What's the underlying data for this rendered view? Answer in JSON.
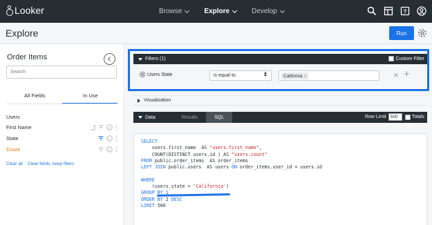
{
  "app": {
    "name": "Looker"
  },
  "nav": {
    "items": [
      {
        "label": "Browse",
        "active": false
      },
      {
        "label": "Explore",
        "active": true
      },
      {
        "label": "Develop",
        "active": false
      }
    ],
    "icons": [
      "search-icon",
      "marketplace-icon",
      "help-icon",
      "user-icon"
    ]
  },
  "header": {
    "title": "Explore",
    "run_label": "Run"
  },
  "sidebar": {
    "title": "Order Items",
    "search_placeholder": "Search",
    "tabs": [
      {
        "label": "All Fields",
        "active": false
      },
      {
        "label": "In Use",
        "active": true
      }
    ],
    "group_label": "Users",
    "fields": [
      {
        "label": "First Name",
        "color": "#262d33",
        "filter_active": false
      },
      {
        "label": "State",
        "color": "#262d33",
        "filter_active": true
      },
      {
        "label": "Count",
        "color": "#e8710a",
        "filter_active": false
      }
    ],
    "links": {
      "clear_all": "Clear all",
      "clear_keep": "Clear fields, keep filters"
    }
  },
  "filters": {
    "header": "Filters (1)",
    "custom_filter_label": "Custom Filter",
    "rows": [
      {
        "field": "Users State",
        "operator": "is equal to",
        "value": "California"
      }
    ]
  },
  "visualization": {
    "label": "Visualization"
  },
  "data_panel": {
    "label": "Data",
    "tabs": [
      {
        "label": "Results",
        "active": false
      },
      {
        "label": "SQL",
        "active": true
      }
    ],
    "row_limit_label": "Row Limit",
    "row_limit_value": "500",
    "totals_label": "Totals"
  },
  "sql": {
    "lines": [
      [
        {
          "t": "SELECT",
          "c": "kw"
        }
      ],
      [
        {
          "t": "    users.first_name  AS ",
          "c": ""
        },
        {
          "t": "\"users.first_name\"",
          "c": "str"
        },
        {
          "t": ",",
          "c": ""
        }
      ],
      [
        {
          "t": "    COUNT(DISTINCT users.id ) AS ",
          "c": ""
        },
        {
          "t": "\"users.count\"",
          "c": "str"
        }
      ],
      [
        {
          "t": "FROM",
          "c": "kw"
        },
        {
          "t": " public.order_items  AS order_items",
          "c": ""
        }
      ],
      [
        {
          "t": "LEFT JOIN",
          "c": "kw"
        },
        {
          "t": " public.users  AS users ",
          "c": ""
        },
        {
          "t": "ON",
          "c": "kw"
        },
        {
          "t": " order_items.user_id = users.id",
          "c": ""
        }
      ],
      [
        {
          "t": "",
          "c": ""
        }
      ],
      [
        {
          "t": "WHERE",
          "c": "kw"
        }
      ],
      [
        {
          "t": "    (users.state = ",
          "c": ""
        },
        {
          "t": "'California'",
          "c": "str"
        },
        {
          "t": ")",
          "c": ""
        }
      ],
      [
        {
          "t": "GROUP BY 1",
          "c": "kw"
        }
      ],
      [
        {
          "t": "ORDER BY",
          "c": "kw"
        },
        {
          "t": " 2 ",
          "c": ""
        },
        {
          "t": "DESC",
          "c": "kw"
        }
      ],
      [
        {
          "t": "LIMIT",
          "c": "kw"
        },
        {
          "t": " 500",
          "c": ""
        }
      ]
    ]
  },
  "colors": {
    "nav_bg": "#262d33",
    "accent": "#1a73e8",
    "count_field": "#e8710a"
  }
}
